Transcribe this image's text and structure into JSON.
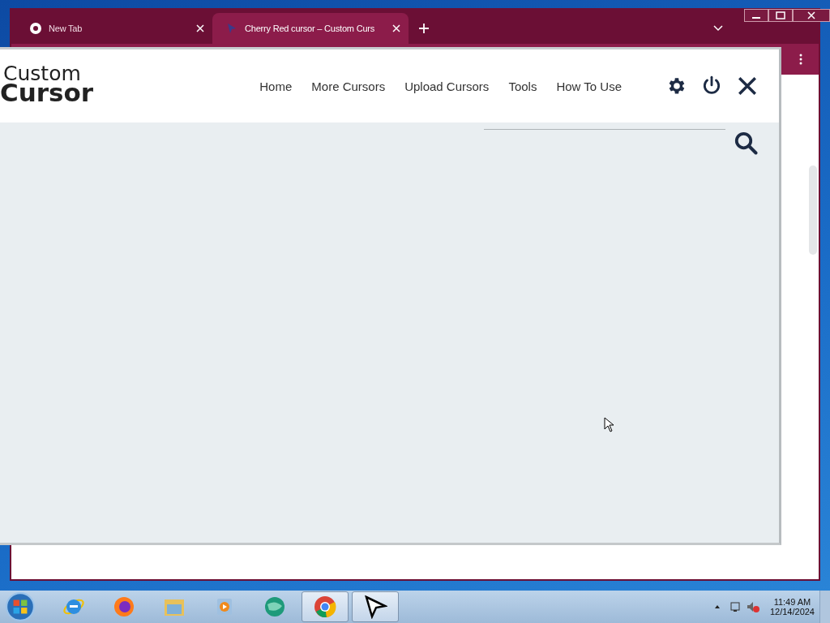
{
  "browser": {
    "tabs": [
      {
        "title": "New Tab",
        "selected": false
      },
      {
        "title": "Cherry Red cursor – Custom Curs",
        "selected": true
      }
    ]
  },
  "popup": {
    "logo": {
      "line_1": "Custom",
      "line_2": "Cursor"
    },
    "nav": [
      "Home",
      "More Cursors",
      "Upload Cursors",
      "Tools",
      "How To Use"
    ]
  },
  "taskbar": {
    "apps": [
      {
        "kind": "ie",
        "selected": false
      },
      {
        "kind": "firefox",
        "selected": false
      },
      {
        "kind": "folder",
        "selected": false
      },
      {
        "kind": "media",
        "selected": false
      },
      {
        "kind": "globe",
        "selected": false
      },
      {
        "kind": "chrome",
        "selected": true
      },
      {
        "kind": "cursor",
        "selected": true
      }
    ],
    "time": "11:49 AM",
    "date": "12/14/2024"
  }
}
